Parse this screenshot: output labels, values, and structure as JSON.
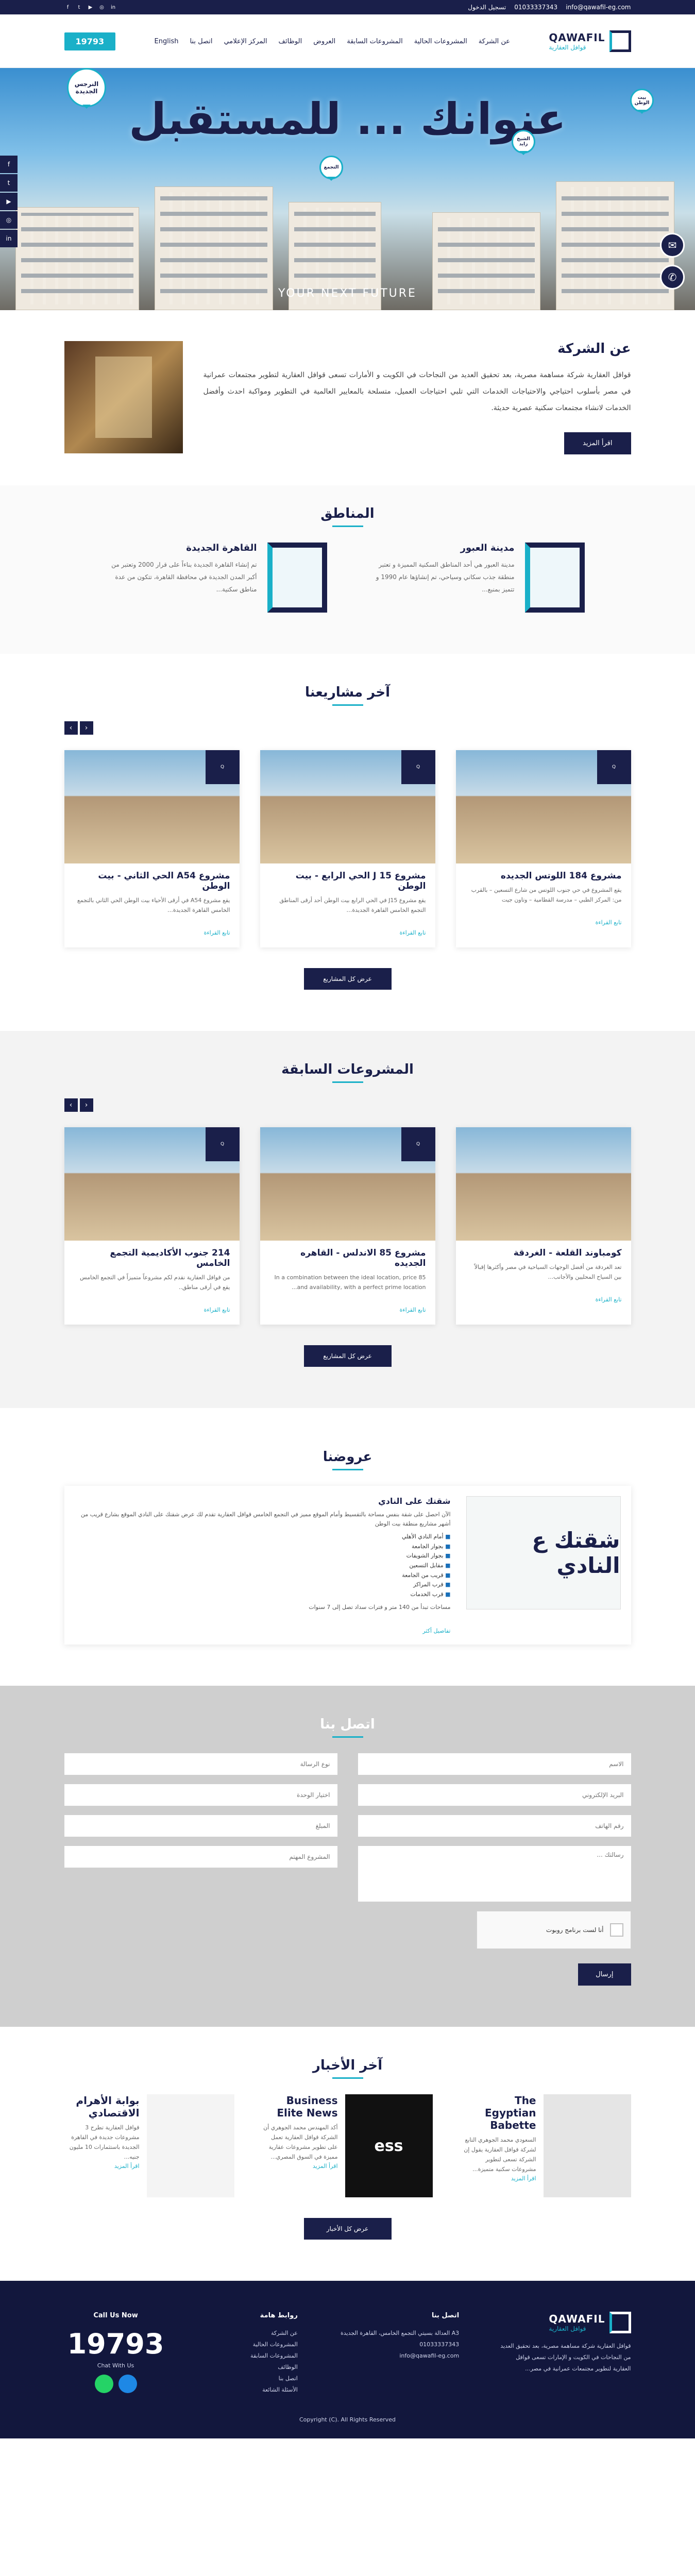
{
  "topbar": {
    "email": "info@qawafil-eg.com",
    "phone": "01033337343",
    "login": "تسجيل الدخول"
  },
  "header": {
    "logo_en": "QAWAFIL",
    "logo_ar": "قوافل العقارية",
    "nav": [
      "عن الشركة",
      "المشروعات الحالية",
      "المشروعات السابقة",
      "العروض",
      "الوظائف",
      "المركز الإعلامي",
      "اتصل بنا",
      "English"
    ],
    "phone": "19793"
  },
  "hero": {
    "title": "عنوانك ... للمستقبل",
    "tagline": "YOUR NEXT FUTURE",
    "pins": [
      "النرجس الجديدة",
      "بيت الوطن",
      "الشيخ زايد",
      "التجمع"
    ]
  },
  "about": {
    "title": "عن الشركة",
    "text": "قوافل العقارية شركة مساهمة مصرية، بعد تحقيق العديد من النجاحات في الكويت و الأمارات تسعى قوافل العقارية لتطوير مجتمعات عمرانية في مصر بأسلوب احتياجي والاحتياجات الخدمات التي تلبي احتياجات العميل، متسلحة بالمعايير العالمية في التطوير ومواكبة احدث وأفضل الخدمات لانشاء مجتمعات سكنية عصرية حديثة.",
    "more": "اقرأ المزيد"
  },
  "areas": {
    "title": "المناطق",
    "items": [
      {
        "name": "مدينة العبور",
        "desc": "مدينة العبور هي أحد المناطق السكنية المميزة و تعتبر منطقة جذب سكاني وسياحي، تم إنشاؤها عام 1990 و تتميز بمنبع..."
      },
      {
        "name": "القاهرة الجديدة",
        "desc": "تم إنشاء القاهرة الجديدة بناءاً على قرار 2000 وتعتبر من أكبر المدن الجديدة في محافظة القاهرة، تتكون من عدة مناطق سكنية..."
      }
    ]
  },
  "latest": {
    "title": "آخر مشاريعنا",
    "items": [
      {
        "title": "مشروع 184 اللوتس الجديده",
        "desc": "يقع المشروع في حي جنوب اللوتس من شارع التسعين – بالقرب من: المركز الطبي – مدرسة القطامية – وتاون جيت",
        "more": "تابع القراءة"
      },
      {
        "title": "مشروع 15 J الحي الرابع - بيت الوطن",
        "desc": "يقع مشروع J15 في الحي الرابع بيت الوطن أحد أرقى المناطق التجمع الخامس القاهرة الجديدة…",
        "more": "تابع القراءة"
      },
      {
        "title": "مشروع A54 الحي الثاني - بيت الوطن",
        "desc": "يقع مشروع A54 في أرقى الأحياء بيت الوطن الحي الثاني بالتجمع الخامس القاهرة الجديدة…",
        "more": "تابع القراءة"
      }
    ],
    "all": "عرض كل المشاريع"
  },
  "previous": {
    "title": "المشروعات السابقة",
    "items": [
      {
        "title": "كومباوند القلعة - الغردقة",
        "desc": "تعد الغردقة من أفضل الوجهات السياحية في مصر وأكثرها إقبالاً بين السياح المحليين والأجانب...",
        "more": "تابع القراءة"
      },
      {
        "title": "مشروع 85 الاندلس - القاهره الجديده",
        "desc": "In a combination between the ideal location, price 85 and availability, with a perfect prime location...",
        "more": "تابع القراءة"
      },
      {
        "title": "214 جنوب الأكاديمية التجمع الخامس",
        "desc": "من قوافل العقارية نقدم لكم مشروعاً متميزاً في التجمع الخامس يقع في أرقى مناطق..",
        "more": "تابع القراءة"
      }
    ],
    "all": "عرض كل المشاريع"
  },
  "offers": {
    "title": "عروضنا",
    "item": {
      "title": "شقتك على النادي",
      "image_text": "شقتك ع النادي",
      "desc": "الآن احصل على شقة بنفس مساحة بالتقسيط وأمام الموقع مميز في التجمع الخامس قوافل العقارية تقدم لك عرض شقتك على النادي الموقع بشارع قريب من أشهر مشاريع منطقة بيت الوطن",
      "features": [
        "أمام النادي الأهلي",
        "بجوار الجامعة",
        "بجوار الشويفات",
        "مقابل التسعين",
        "قريب من الجامعة",
        "قرب المراكز",
        "قرب الخدمات"
      ],
      "note": "مساحات تبدأ من 140 متر و فترات سداد تصل إلى 7 سنوات",
      "more": "تفاصيل أكثر"
    }
  },
  "contact": {
    "title": "اتصل بنا",
    "name": "الاسم",
    "email": "البريد الإلكتروني",
    "phone": "رقم الهاتف",
    "message": "رسالتك ...",
    "type": "نوع الرسالة",
    "unit": "اختيار الوحدة",
    "budget": "المبلغ",
    "project": "المشروع المهتم",
    "captcha": "أنا لست برنامج روبوت",
    "send": "إرسال"
  },
  "news": {
    "title": "آخر الأخبار",
    "items": [
      {
        "title": "The Egyptian Babette",
        "desc": "السعودي محمد الجوهري التابع لشركة قوافل العقارية يقول إن الشركة تسعى لتطوير مشروعات سكنية متميزة...",
        "more": "اقرأ المزيد"
      },
      {
        "title": "Business Elite News",
        "desc": "أكد المهندس محمد الجوهري أن الشركة قوافل العقارية تعمل على تطوير مشروعات عقارية مميزة في السوق المصري...",
        "more": "اقرأ المزيد"
      },
      {
        "title": "بوابة الأهرام الاقتصادي",
        "desc": "قوافل العقارية تطرح 3 مشروعات جديدة في القاهرة الجديدة باستثمارات 10 مليون جنيه...",
        "more": "اقرأ المزيد"
      }
    ],
    "all": "عرض كل الأخبار"
  },
  "footer": {
    "about": "قوافل العقارية شركة مساهمة مصرية، بعد تحقيق العديد من النجاحات في الكويت و الإمارات تسعى قوافل العقارية لتطوير مجتمعات عمرانية في مصر...",
    "contact_title": "اتصل بنا",
    "address": "A3 العدالة بسيتي التجمع الخامس، القاهرة الجديدة",
    "phone": "01033337343",
    "email": "info@qawafil-eg.com",
    "links_title": "روابط هامة",
    "links": [
      "عن الشركة",
      "المشروعات الحالية",
      "المشروعات السابقة",
      "الوظائف",
      "اتصل بنا",
      "الأسئلة الشائعة"
    ],
    "call_us": "Call Us Now",
    "hotline": "19793",
    "chat": "Chat With Us",
    "copyright": "Copyright (C). All Rights Reserved"
  }
}
